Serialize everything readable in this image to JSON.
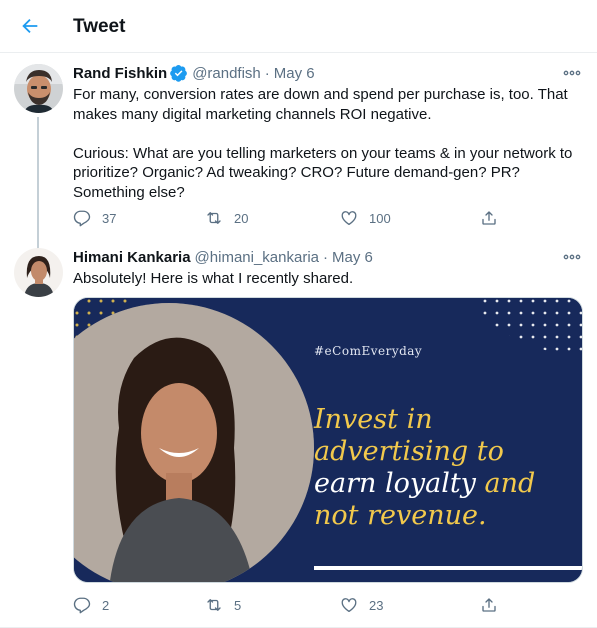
{
  "header": {
    "back_icon": "arrow-left-icon",
    "title": "Tweet"
  },
  "colors": {
    "accent": "#1d9bf0",
    "text_secondary": "#5b7083",
    "media_background": "#17295b",
    "media_highlight": "#f2c94c"
  },
  "tweets": [
    {
      "author": {
        "name": "Rand Fishkin",
        "verified": true,
        "handle": "@randfish"
      },
      "separator": "·",
      "date": "May 6",
      "text": [
        "For many, conversion rates are down and spend per purchase is, too. That makes many digital marketing channels ROI negative.",
        "Curious: What are you telling marketers on your teams & in your network to prioritize? Organic? Ad tweaking? CRO? Future demand-gen? PR? Something else?"
      ],
      "actions": {
        "replies": "37",
        "retweets": "20",
        "likes": "100"
      }
    },
    {
      "author": {
        "name": "Himani Kankaria",
        "verified": false,
        "handle": "@himani_kankaria"
      },
      "separator": "·",
      "date": "May 6",
      "text": "Absolutely! Here is what I recently shared.",
      "media": {
        "hashtag": "#eComEveryday",
        "quote_lines": [
          [
            {
              "text": "Invest in",
              "color": "yellow"
            }
          ],
          [
            {
              "text": "advertising to",
              "color": "yellow"
            }
          ],
          [
            {
              "text": "earn loyalty ",
              "color": "white"
            },
            {
              "text": "and",
              "color": "yellow"
            }
          ],
          [
            {
              "text": "not revenue.",
              "color": "yellow"
            }
          ]
        ]
      },
      "actions": {
        "replies": "2",
        "retweets": "5",
        "likes": "23"
      }
    }
  ]
}
